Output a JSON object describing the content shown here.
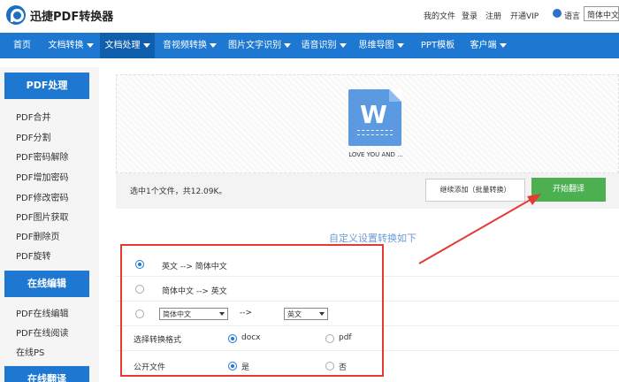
{
  "header": {
    "brand": "迅捷PDF转换器",
    "links": [
      "我的文件",
      "登录",
      "注册",
      "开通VIP"
    ],
    "language_label": "语言",
    "language_value": "简体中文"
  },
  "nav": {
    "items": [
      {
        "label": "首页",
        "caret": false
      },
      {
        "label": "文档转换",
        "caret": true
      },
      {
        "label": "文档处理",
        "caret": true,
        "active": true
      },
      {
        "label": "音视频转换",
        "caret": true
      },
      {
        "label": "图片文字识别",
        "caret": true
      },
      {
        "label": "语音识别",
        "caret": true
      },
      {
        "label": "思维导图",
        "caret": true
      },
      {
        "label": "PPT模板",
        "caret": false
      },
      {
        "label": "客户端",
        "caret": true
      }
    ]
  },
  "sidebar": {
    "sections": [
      {
        "title": "PDF处理",
        "items": [
          "PDF合并",
          "PDF分割",
          "PDF密码解除",
          "PDF增加密码",
          "PDF修改密码",
          "PDF图片获取",
          "PDF删除页",
          "PDF旋转"
        ]
      },
      {
        "title": "在线编辑",
        "items": [
          "PDF在线编辑",
          "PDF在线阅读",
          "在线PS"
        ]
      },
      {
        "title": "在线翻译",
        "items": []
      }
    ]
  },
  "upload": {
    "file_icon_letter": "W",
    "file_name": "LOVE YOU AND ...",
    "info_text": "选中1个文件，共12.09K。",
    "add_button": "继续添加（批量转换）",
    "start_button": "开始翻译"
  },
  "settings": {
    "title": "自定义设置转换如下",
    "direction_options": [
      {
        "label": "英文 --> 简体中文",
        "selected": true
      },
      {
        "label": "简体中文 --> 英文",
        "selected": false
      }
    ],
    "custom": {
      "from": "简体中文",
      "arrow": "-->",
      "to": "英文",
      "selected": false
    },
    "format": {
      "label": "选择转换格式",
      "options": [
        {
          "label": "docx",
          "selected": true
        },
        {
          "label": "pdf",
          "selected": false
        }
      ]
    },
    "public": {
      "label": "公开文件",
      "options": [
        {
          "label": "是",
          "selected": true
        },
        {
          "label": "否",
          "selected": false
        }
      ]
    }
  },
  "colors": {
    "nav_blue": "#1e78d2",
    "start_green": "#4caf50",
    "annotation_red": "#e53935"
  }
}
